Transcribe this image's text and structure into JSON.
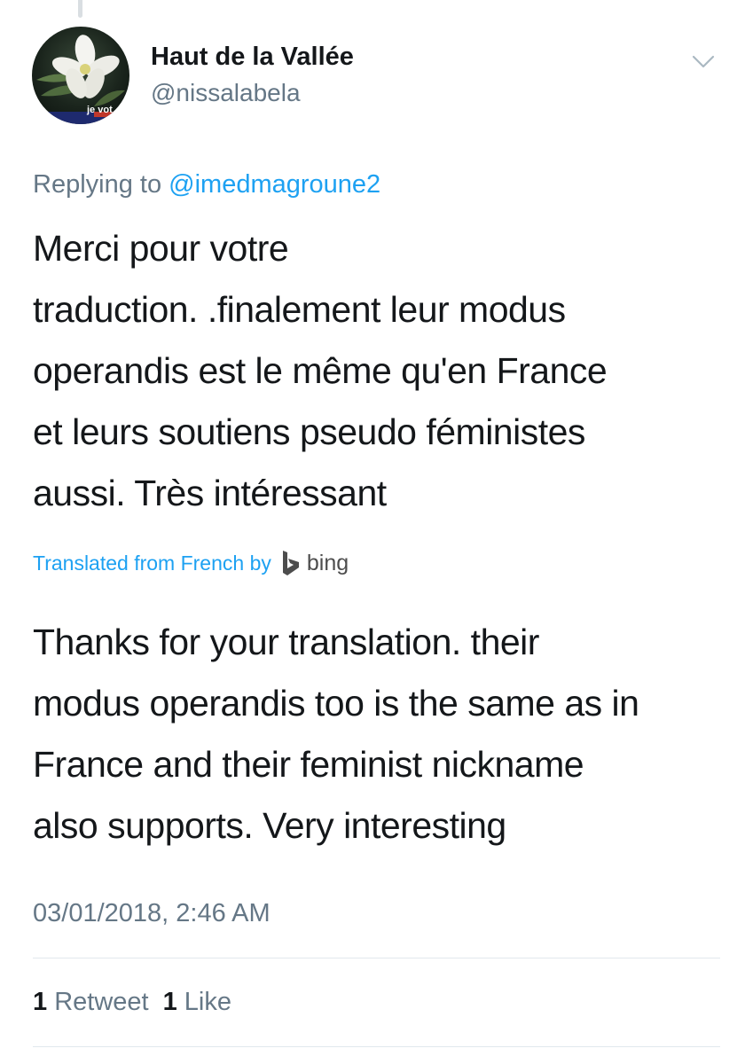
{
  "tweet": {
    "author": {
      "name": "Haut de la Vallée",
      "handle": "@nissalabela",
      "avatar_caption": "je vot"
    },
    "replying_prefix": "Replying to",
    "replying_to": "@imedmagroune2",
    "text_lines": [
      "Merci pour votre",
      "traduction. .finalement leur modus",
      "operandis est le même qu'en France",
      "et leurs soutiens pseudo féministes",
      "aussi. Très intéressant"
    ],
    "translation_label": "Translated from French by",
    "translation_provider": "bing",
    "translation_lines": [
      "Thanks for your translation. their",
      "modus operandis too is the same as in",
      "France and their feminist nickname",
      "also supports. Very interesting"
    ],
    "timestamp": "03/01/2018, 2:46 AM",
    "stats": {
      "retweet_count": "1",
      "retweet_label": "Retweet",
      "like_count": "1",
      "like_label": "Like"
    }
  },
  "colors": {
    "text": "#14171a",
    "secondary": "#657786",
    "accent": "#1da1f2",
    "divider": "#e1e8ed"
  },
  "icons": {
    "caret": "chevron-down-icon",
    "bing": "bing-logo-icon"
  }
}
